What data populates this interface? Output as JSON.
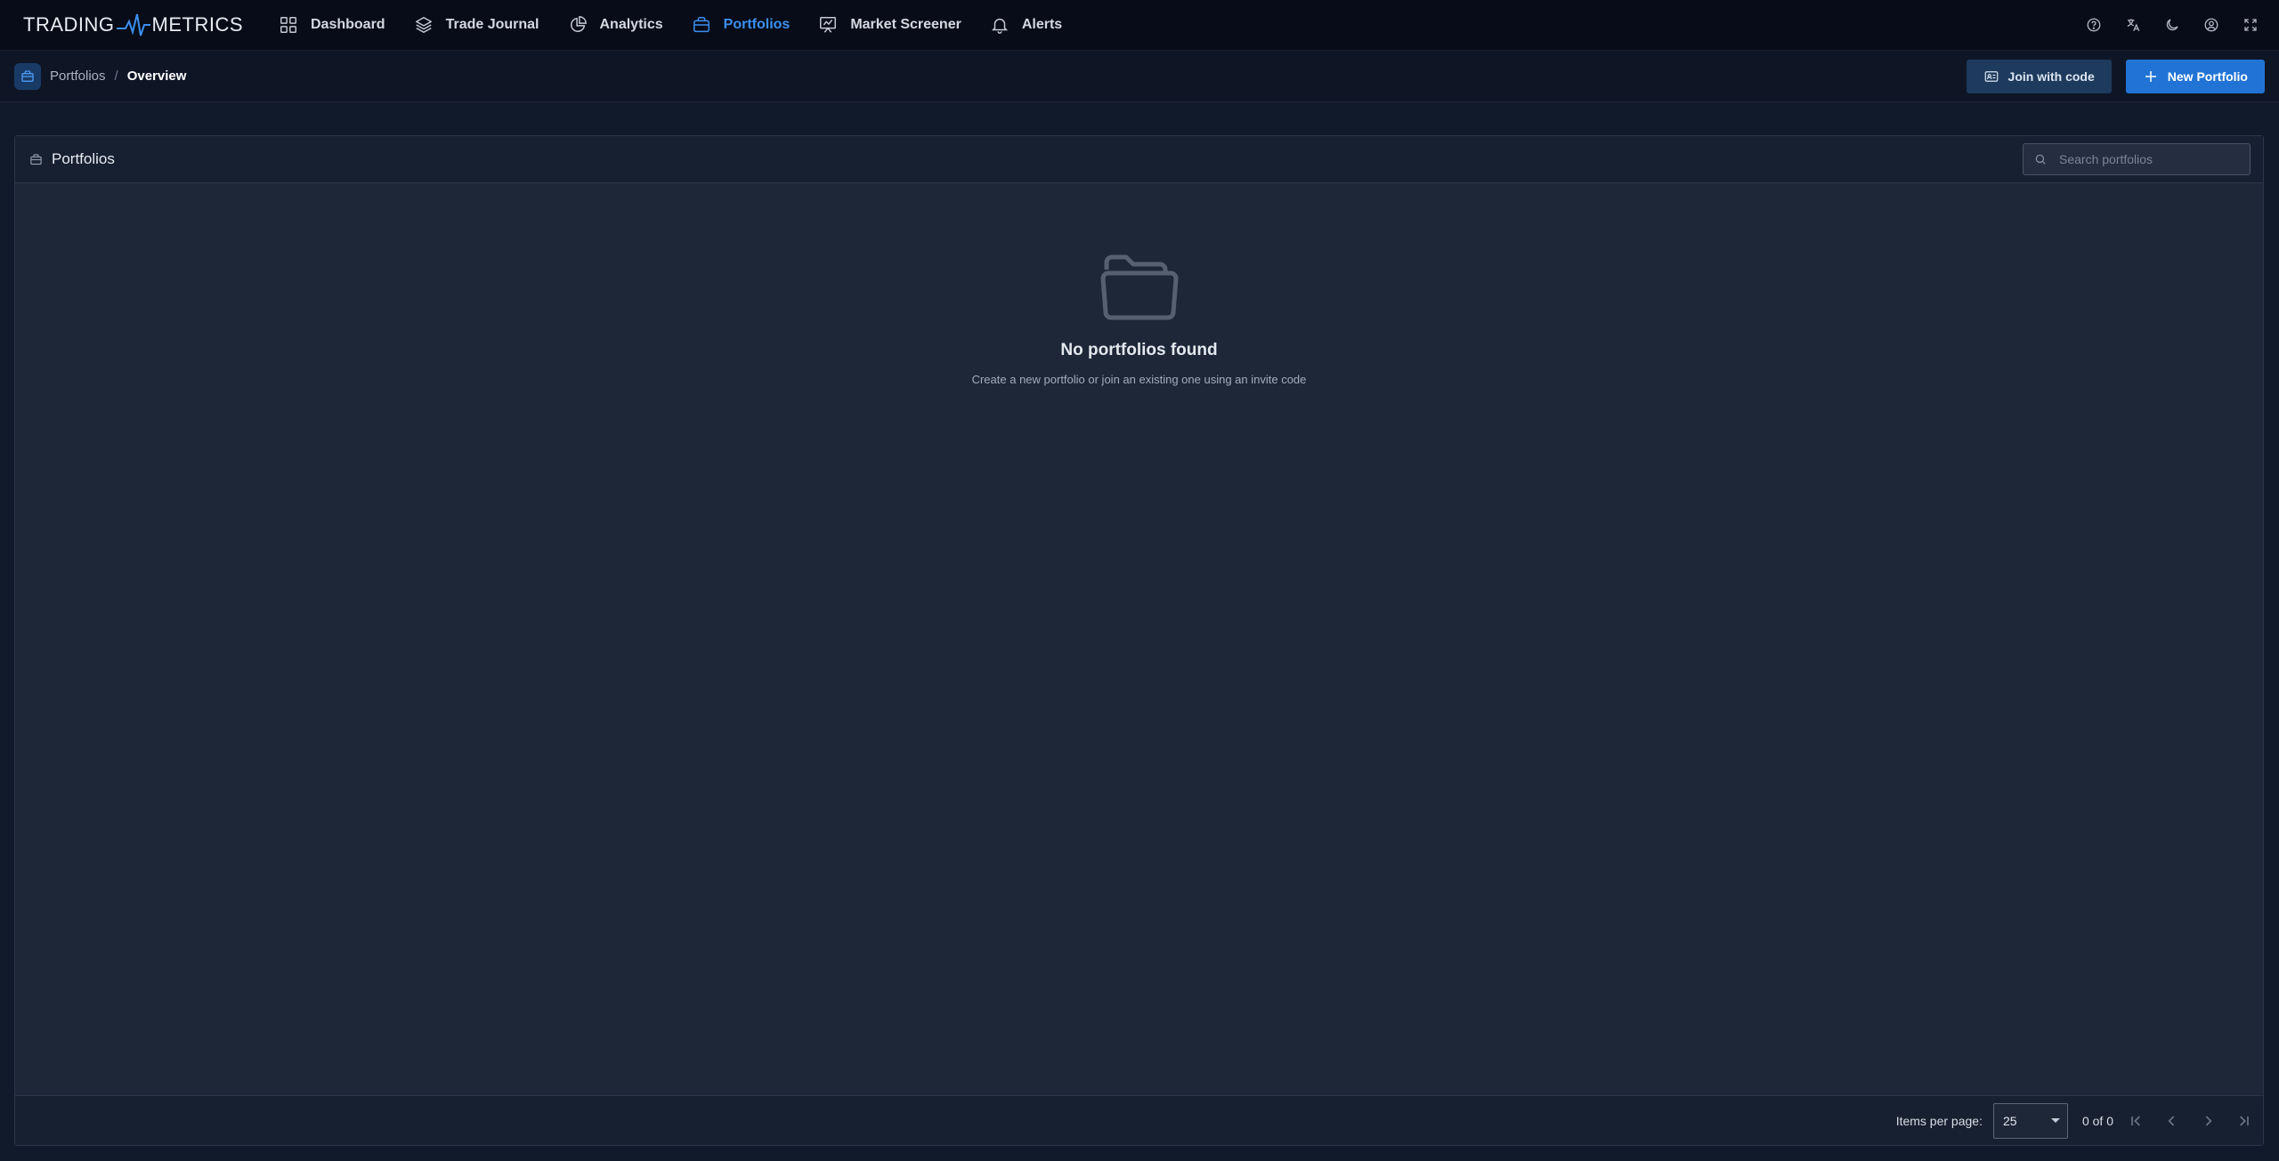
{
  "app": {
    "logo_left": "TRADING",
    "logo_right": "METRICS"
  },
  "nav": {
    "items": [
      {
        "label": "Dashboard",
        "icon": "grid-icon",
        "active": false
      },
      {
        "label": "Trade Journal",
        "icon": "layers-icon",
        "active": false
      },
      {
        "label": "Analytics",
        "icon": "pie-chart-icon",
        "active": false
      },
      {
        "label": "Portfolios",
        "icon": "briefcase-icon",
        "active": true
      },
      {
        "label": "Market Screener",
        "icon": "presentation-chart-icon",
        "active": false
      },
      {
        "label": "Alerts",
        "icon": "bell-icon",
        "active": false
      }
    ],
    "right_icons": [
      "help-icon",
      "translate-icon",
      "moon-icon",
      "user-icon",
      "fullscreen-icon"
    ]
  },
  "breadcrumb": {
    "parent": "Portfolios",
    "separator": "/",
    "current": "Overview"
  },
  "actions": {
    "join_label": "Join with code",
    "new_label": "New Portfolio"
  },
  "panel": {
    "title": "Portfolios",
    "search_placeholder": "Search portfolios",
    "search_value": ""
  },
  "empty_state": {
    "title": "No portfolios found",
    "message": "Create a new portfolio or join an existing one using an invite code"
  },
  "pagination": {
    "items_per_page_label": "Items per page:",
    "items_per_page": "25",
    "range": "0 of 0"
  },
  "colors": {
    "accent": "#2174d6",
    "active_nav": "#3b8ff0",
    "background": "#111a2a",
    "panel": "#1d2738"
  }
}
